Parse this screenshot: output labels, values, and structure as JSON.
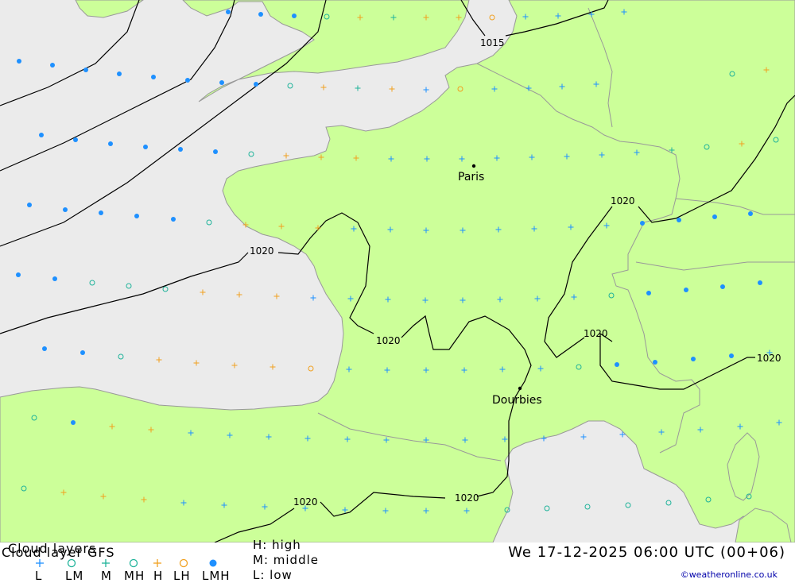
{
  "title_line1": "Cloud layers",
  "title_line2": "Cloud layer  GFS",
  "datetime": "We 17-12-2025 06:00 UTC (00+06)",
  "credit": "©weatheronline.co.uk",
  "legend_levels": [
    "L",
    "LM",
    "M",
    "MH",
    "H",
    "LH",
    "LMH"
  ],
  "legend_defs": [
    "H: high",
    "M: middle",
    "L: low"
  ],
  "cities": [
    "Paris",
    "Dourbies"
  ],
  "isobar_labels": [
    "1015",
    "1020",
    "1020",
    "1020",
    "1020",
    "1020",
    "1020",
    "1020",
    "1020"
  ],
  "colors": {
    "land": "#ccff99",
    "sea": "#ebebeb",
    "low": "#1e90ff",
    "middle": "#1fb39a",
    "high": "#f0a020",
    "full": "#1e90ff",
    "isobar": "#000000",
    "border": "#999999"
  },
  "symbol_names": {
    "L": "plus-blue",
    "LM": "ring-teal",
    "M": "plus-teal",
    "MH": "ring-teal",
    "H": "plus-orange",
    "LH": "ring-orange",
    "LMH": "dot-blue"
  }
}
